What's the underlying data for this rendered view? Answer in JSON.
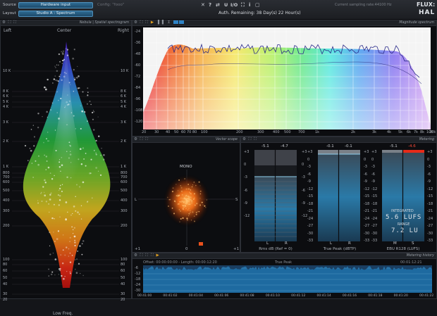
{
  "topbar": {
    "source_label": "Source",
    "source_value": "Hardware input",
    "layout_label": "Layout",
    "layout_value": "Studio A : Spectrum",
    "config_label": "Config: \"fooo\"",
    "auth_text": "Auth. Remaining: 38 Day(s) 22 Hour(s)",
    "sampling_rate": "Current sampling rate:44100 Hz",
    "brand_top": "FLUX:",
    "brand_bottom": "HAL"
  },
  "spatial": {
    "title": "Nebula | Spatial spectrogram",
    "left_label": "Left",
    "center_label": "Center",
    "right_label": "Right",
    "bottom_label": "Low Freq.",
    "freq_ticks": [
      "10 K",
      "8 K",
      "6 K",
      "5 K",
      "4 K",
      "3 K",
      "2 K",
      "1 K",
      "800",
      "700",
      "600",
      "500",
      "400",
      "300",
      "200",
      "100",
      "80",
      "60",
      "50",
      "40",
      "30",
      "20"
    ]
  },
  "magnitude": {
    "title": "Magnitude spectrum",
    "db_ticks": [
      "-24",
      "-36",
      "-48",
      "-60",
      "-72",
      "-84",
      "-96",
      "-108",
      "-120"
    ],
    "freq_ticks": [
      "20",
      "30",
      "40",
      "50",
      "60",
      "70",
      "80",
      "100",
      "200",
      "300",
      "400",
      "500",
      "700",
      "1k",
      "2k",
      "3k",
      "4k",
      "5k",
      "6k",
      "7k",
      "8k",
      "10k",
      "20k"
    ]
  },
  "vector": {
    "title": "Vector scope",
    "mono_label": "MONO",
    "left_label": "L",
    "right_label": "S",
    "bottom_left": "+1",
    "bottom_center": "0",
    "bottom_right": "+1"
  },
  "meters": {
    "title": "Metering",
    "scale_left": [
      "+3",
      "0",
      "-3",
      "-6",
      "-9",
      "-12"
    ],
    "rms": {
      "caption": "Rms dB (Ref = 0)",
      "peak_l": "-5.1",
      "peak_r": "-4.7",
      "ch_l": "L",
      "ch_r": "R"
    },
    "truepeak": {
      "caption": "True Peak (dBTP)",
      "peak_l": "-0.1",
      "peak_r": "-0.1",
      "scale": [
        "+3",
        "0",
        "-3",
        "-6",
        "-9",
        "-12",
        "-15",
        "-18",
        "-21",
        "-24",
        "-27",
        "-30",
        "-33"
      ],
      "ch_l": "L",
      "ch_r": "R"
    },
    "ebu": {
      "caption": "EBU R128 (LUFS)",
      "peak_l": "-5.1",
      "peak_r": "-4.6",
      "scale": [
        "+3",
        "0",
        "-3",
        "-6",
        "-9",
        "-12",
        "-15",
        "-18",
        "-21",
        "-24",
        "-27",
        "-30",
        "-33"
      ],
      "integrated_label": "INTEGRATED",
      "integrated_value": "5.6 LUFS",
      "range_label": "RANGE",
      "range_value": "7.2 LU",
      "ch_m": "M",
      "ch_s": "S"
    }
  },
  "history": {
    "title": "Metering history",
    "offset_text": "Offset: 00:00:00:00 - Length: 00:00:12:20",
    "center_label": "True Peak",
    "time_right": "00:01:12:21",
    "db_ticks": [
      "-6",
      "-12",
      "-18",
      "-24",
      "-30"
    ],
    "time_ticks": [
      "00:41:00",
      "00:41:02",
      "00:41:04",
      "00:41:06",
      "00:41:08",
      "00:41:10",
      "00:41:12",
      "00:41:14",
      "00:41:16",
      "00:41:18",
      "00:41:20",
      "00:41:22"
    ]
  }
}
